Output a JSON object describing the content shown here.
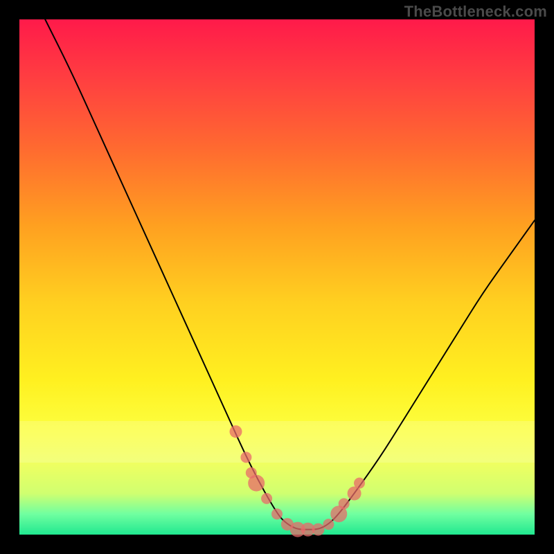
{
  "watermark": "TheBottleneck.com",
  "chart_data": {
    "type": "line",
    "title": "",
    "xlabel": "",
    "ylabel": "",
    "xlim": [
      0,
      100
    ],
    "ylim": [
      0,
      100
    ],
    "series": [
      {
        "name": "bottleneck-curve",
        "x": [
          5,
          10,
          15,
          20,
          25,
          30,
          35,
          40,
          45,
          50,
          52,
          54,
          56,
          58,
          60,
          62,
          65,
          70,
          75,
          80,
          85,
          90,
          95,
          100
        ],
        "values": [
          100,
          90,
          79,
          68,
          57,
          46,
          35,
          24,
          13,
          4,
          2,
          1,
          1,
          1,
          2,
          4,
          8,
          15,
          23,
          31,
          39,
          47,
          54,
          61
        ]
      }
    ],
    "markers": {
      "name": "highlight-dots",
      "x": [
        42,
        44,
        45,
        46,
        48,
        50,
        52,
        54,
        56,
        58,
        60,
        62,
        63,
        65,
        66
      ],
      "y": [
        20,
        15,
        12,
        10,
        7,
        4,
        2,
        1,
        1,
        1,
        2,
        4,
        6,
        8,
        10
      ],
      "r": [
        9,
        8,
        8,
        12,
        8,
        8,
        9,
        11,
        10,
        9,
        8,
        12,
        8,
        10,
        8
      ]
    },
    "highlight_band": {
      "y_from": 78,
      "y_to": 86
    }
  }
}
